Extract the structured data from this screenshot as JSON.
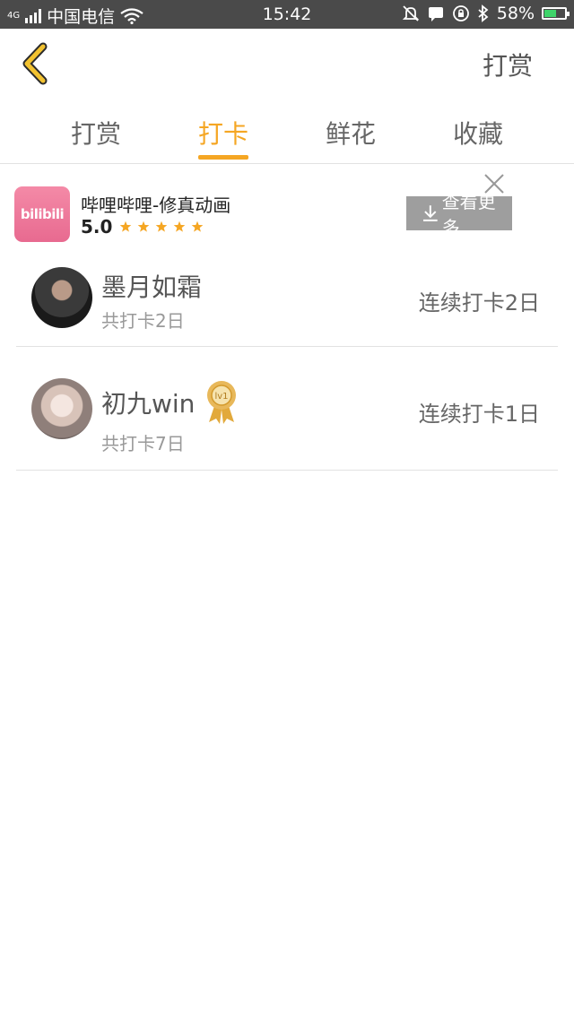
{
  "status_bar": {
    "network": "4G",
    "carrier": "中国电信",
    "time": "15:42",
    "battery": "58%",
    "battery_level": 0.58,
    "icons": [
      "wifi-icon",
      "mute-icon",
      "message-icon",
      "rotation-lock-icon",
      "bluetooth-icon",
      "battery-icon"
    ]
  },
  "header": {
    "back_icon": "chevron-left-icon",
    "action_label": "打赏"
  },
  "tabs": [
    {
      "label": "打赏",
      "active": false
    },
    {
      "label": "打卡",
      "active": true
    },
    {
      "label": "鲜花",
      "active": false
    },
    {
      "label": "收藏",
      "active": false
    }
  ],
  "ad": {
    "icon_text": "bilibili",
    "title": "哔哩哔哩-修真动画",
    "rating": "5.0",
    "stars": 5,
    "button_label": "查看更多",
    "colors": {
      "star": "#f5a623",
      "button": "#9e9e9e"
    }
  },
  "list": [
    {
      "name": "墨月如霜",
      "total": "共打卡2日",
      "streak": "连续打卡2日",
      "badge": ""
    },
    {
      "name": "初九win",
      "total": "共打卡7日",
      "streak": "连续打卡1日",
      "badge": "lv1"
    }
  ],
  "colors": {
    "accent": "#f5a623",
    "back_icon": "#f2c230"
  }
}
